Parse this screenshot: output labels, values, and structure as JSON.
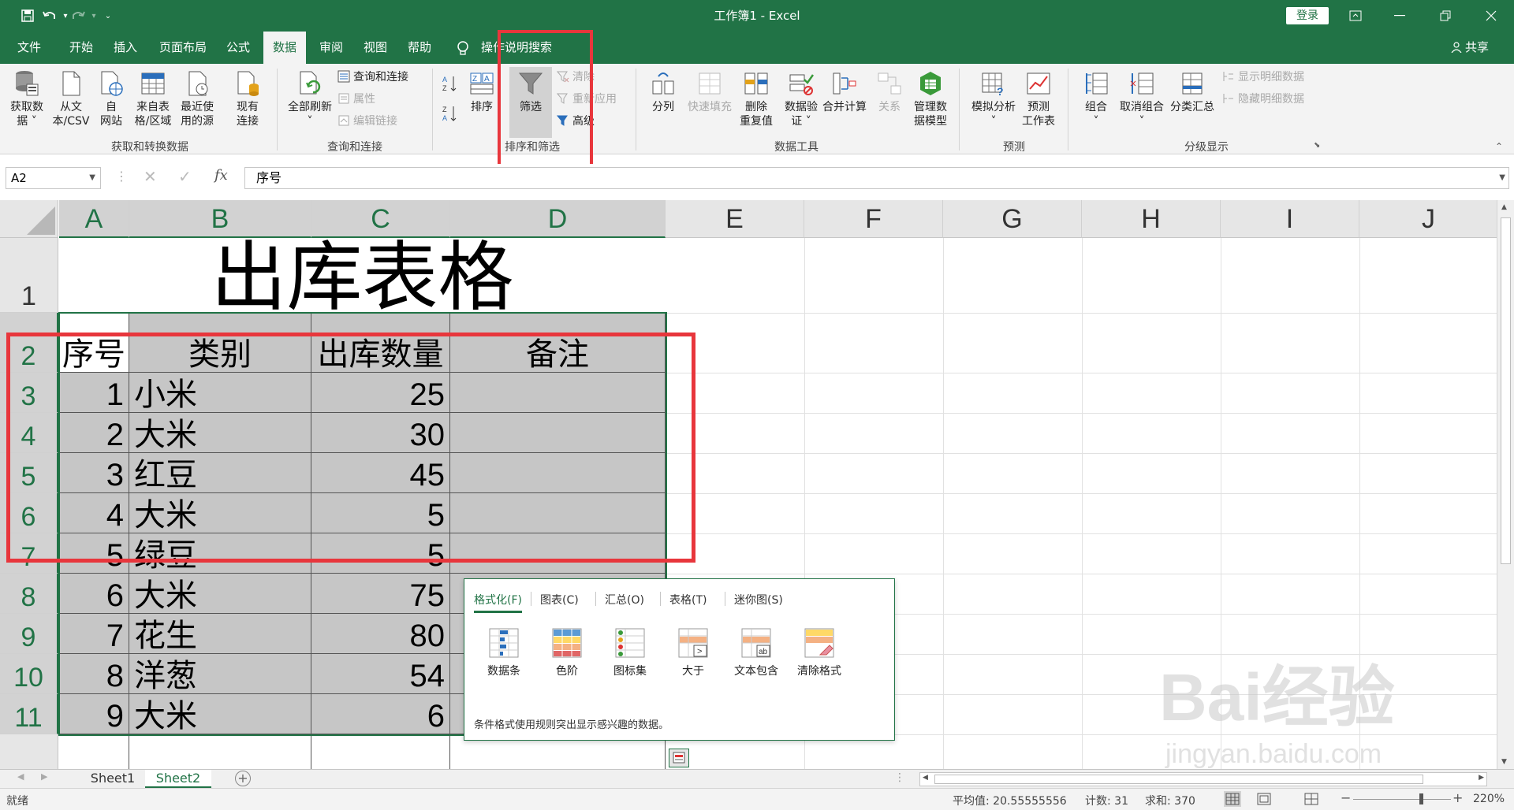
{
  "window": {
    "title": "工作簿1  -  Excel",
    "login": "登录",
    "share": "共享"
  },
  "tabs": [
    "文件",
    "开始",
    "插入",
    "页面布局",
    "公式",
    "数据",
    "审阅",
    "视图",
    "帮助"
  ],
  "active_tab": "数据",
  "tell_me": "操作说明搜索",
  "ribbon": {
    "get_data": [
      "获取数",
      "据 ˅"
    ],
    "from_text": [
      "从文",
      "本/CSV"
    ],
    "from_web": [
      "自",
      "网站"
    ],
    "from_table": [
      "来自表",
      "格/区域"
    ],
    "recent_sources": [
      "最近使",
      "用的源"
    ],
    "existing_conn": [
      "现有",
      "连接"
    ],
    "group_get": "获取和转换数据",
    "refresh_all": [
      "全部刷新",
      "˅"
    ],
    "queries_conn": "查询和连接",
    "properties": "属性",
    "edit_links": "编辑链接",
    "group_query": "查询和连接",
    "sort": "排序",
    "filter": "筛选",
    "clear": "清除",
    "reapply": "重新应用",
    "advanced": "高级",
    "group_sort": "排序和筛选",
    "text_to_col": "分列",
    "flash_fill": "快速填充",
    "remove_dup": [
      "删除",
      "重复值"
    ],
    "data_valid": [
      "数据验",
      "证 ˅"
    ],
    "consolidate": "合并计算",
    "relations": "关系",
    "data_model": [
      "管理数",
      "据模型"
    ],
    "group_tools": "数据工具",
    "what_if": [
      "模拟分析",
      "˅"
    ],
    "forecast": [
      "预测",
      "工作表"
    ],
    "group_forecast": "预测",
    "group_btn": [
      "组合",
      "˅"
    ],
    "ungroup": [
      "取消组合",
      "˅"
    ],
    "subtotal": "分类汇总",
    "show_detail": "显示明细数据",
    "hide_detail": "隐藏明细数据",
    "group_outline": "分级显示"
  },
  "formula_bar": {
    "name_box": "A2",
    "formula": "序号",
    "fx": "fx"
  },
  "columns": [
    "A",
    "B",
    "C",
    "D",
    "E",
    "F",
    "G",
    "H",
    "I",
    "J"
  ],
  "rows": [
    "1",
    "2",
    "3",
    "4",
    "5",
    "6",
    "7",
    "8",
    "9",
    "10",
    "11"
  ],
  "sheet": {
    "title": "出库表格",
    "headers": [
      "序号",
      "类别",
      "出库数量",
      "备注"
    ],
    "data": [
      [
        "1",
        "小米",
        "25",
        ""
      ],
      [
        "2",
        "大米",
        "30",
        ""
      ],
      [
        "3",
        "红豆",
        "45",
        ""
      ],
      [
        "4",
        "大米",
        "5",
        ""
      ],
      [
        "5",
        "绿豆",
        "5",
        ""
      ],
      [
        "6",
        "大米",
        "75",
        ""
      ],
      [
        "7",
        "花生",
        "80",
        ""
      ],
      [
        "8",
        "洋葱",
        "54",
        ""
      ],
      [
        "9",
        "大米",
        "6",
        ""
      ]
    ]
  },
  "quick_analysis": {
    "tabs": [
      "格式化(F)",
      "图表(C)",
      "汇总(O)",
      "表格(T)",
      "迷你图(S)"
    ],
    "items": [
      "数据条",
      "色阶",
      "图标集",
      "大于",
      "文本包含",
      "清除格式"
    ],
    "description": "条件格式使用规则突出显示感兴趣的数据。"
  },
  "sheet_tabs": [
    "Sheet1",
    "Sheet2"
  ],
  "active_sheet": "Sheet2",
  "status": {
    "ready": "就绪",
    "average": "平均值: 20.55555556",
    "count": "计数: 31",
    "sum": "求和: 370",
    "zoom": "220%"
  },
  "watermark": {
    "main": "Bai经验",
    "sub": "jingyan.baidu.com"
  },
  "colors": {
    "excel_green": "#217346",
    "highlight_red": "#e8363c",
    "selection_gray": "#c6c6c6"
  }
}
